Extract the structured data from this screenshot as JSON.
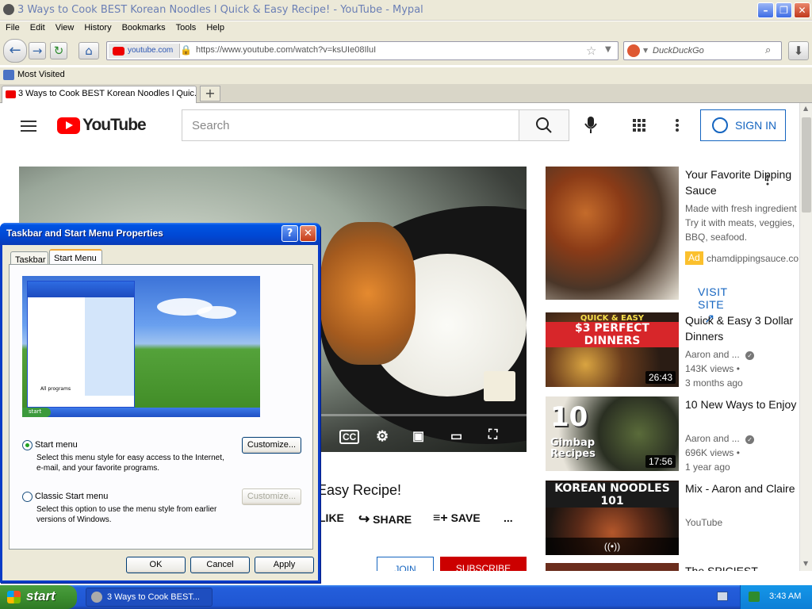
{
  "browser": {
    "window_title": "3 Ways to Cook BEST Korean Noodles l Quick & Easy Recipe! - YouTube - Mypal",
    "menu": [
      "File",
      "Edit",
      "View",
      "History",
      "Bookmarks",
      "Tools",
      "Help"
    ],
    "site_identity": "youtube.com",
    "url": "https://www.youtube.com/watch?v=ksUIe08IluI",
    "search_placeholder": "DuckDuckGo",
    "bookmarks": [
      "Most Visited"
    ],
    "tab_title": "3 Ways to Cook BEST Korean Noodles l Quic...",
    "new_tab_label": "+"
  },
  "youtube": {
    "logo_text": "YouTube",
    "search_placeholder": "Search",
    "sign_in_label": "SIGN IN",
    "video_title_fragment": "Easy Recipe!",
    "actions": {
      "like": "LIKE",
      "share": "SHARE",
      "save": "SAVE",
      "more": "..."
    },
    "join_label": "JOIN",
    "subscribe_label": "SUBSCRIBE",
    "ad": {
      "title": "Your Favorite Dipping Sauce",
      "desc1": "Made with fresh ingredient",
      "desc2": "Try it with meats, veggies,",
      "desc3": "BBQ, seafood.",
      "badge": "Ad",
      "domain": "chamdippingsauce.co",
      "cta": "VISIT SITE"
    },
    "recommendations": [
      {
        "title": "Quick & Easy 3 Dollar Dinners",
        "channel": "Aaron and ...",
        "views": "143K views •",
        "age": "3 months ago",
        "duration": "26:43",
        "overlay_top": "QUICK & EASY",
        "overlay_main": "$3 PERFECT DINNERS"
      },
      {
        "title": "10 New Ways to Enjoy",
        "channel": "Aaron and ...",
        "views": "696K views •",
        "age": "1 year ago",
        "duration": "17:56",
        "overlay_num": "10",
        "overlay_main": "Gimbap Recipes"
      },
      {
        "title": "Mix - Aaron and Claire",
        "channel": "YouTube",
        "overlay_main": "KOREAN NOODLES 101"
      },
      {
        "title": "The SPICIEST"
      }
    ]
  },
  "dialog": {
    "title": "Taskbar and Start Menu Properties",
    "help_label": "?",
    "close_label": "✕",
    "tabs": [
      "Taskbar",
      "Start Menu"
    ],
    "preview_start": "start",
    "preview_all_programs": "All programs",
    "option1": {
      "label": "Start menu",
      "desc": "Select this menu style for easy access to the Internet, e-mail, and your favorite programs.",
      "button": "Customize..."
    },
    "option2": {
      "label": "Classic Start menu",
      "desc": "Select this option to use the menu style from earlier versions of Windows.",
      "button": "Customize..."
    },
    "ok": "OK",
    "cancel": "Cancel",
    "apply": "Apply"
  },
  "taskbar": {
    "start_label": "start",
    "task_item": "3 Ways to Cook BEST...",
    "clock": "3:43 AM"
  }
}
